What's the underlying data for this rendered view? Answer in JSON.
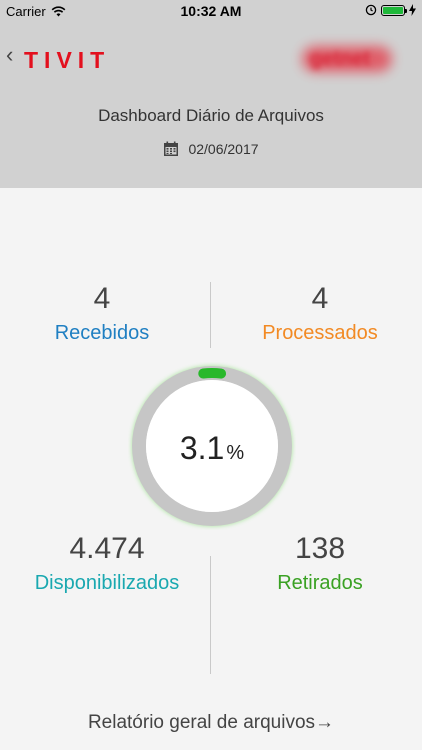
{
  "status_bar": {
    "carrier": "Carrier",
    "time": "10:32 AM"
  },
  "header": {
    "back_symbol": "‹",
    "logo": "TIVIT",
    "partner_logo": "getnet",
    "title": "Dashboard Diário de Arquivos",
    "date": "02/06/2017"
  },
  "stats": {
    "received": {
      "value": "4",
      "label": "Recebidos"
    },
    "processed": {
      "value": "4",
      "label": "Processados"
    },
    "available": {
      "value": "4.474",
      "label": "Disponibilizados"
    },
    "withdrawn": {
      "value": "138",
      "label": "Retirados"
    }
  },
  "gauge": {
    "value": "3.1",
    "unit": "%",
    "fraction": 0.031
  },
  "footer": {
    "link": "Relatório geral de arquivos→"
  },
  "colors": {
    "blue": "#1f7fc2",
    "orange": "#f28a24",
    "teal": "#1aa8b0",
    "green": "#3aa123",
    "brand_red": "#e3101e"
  }
}
